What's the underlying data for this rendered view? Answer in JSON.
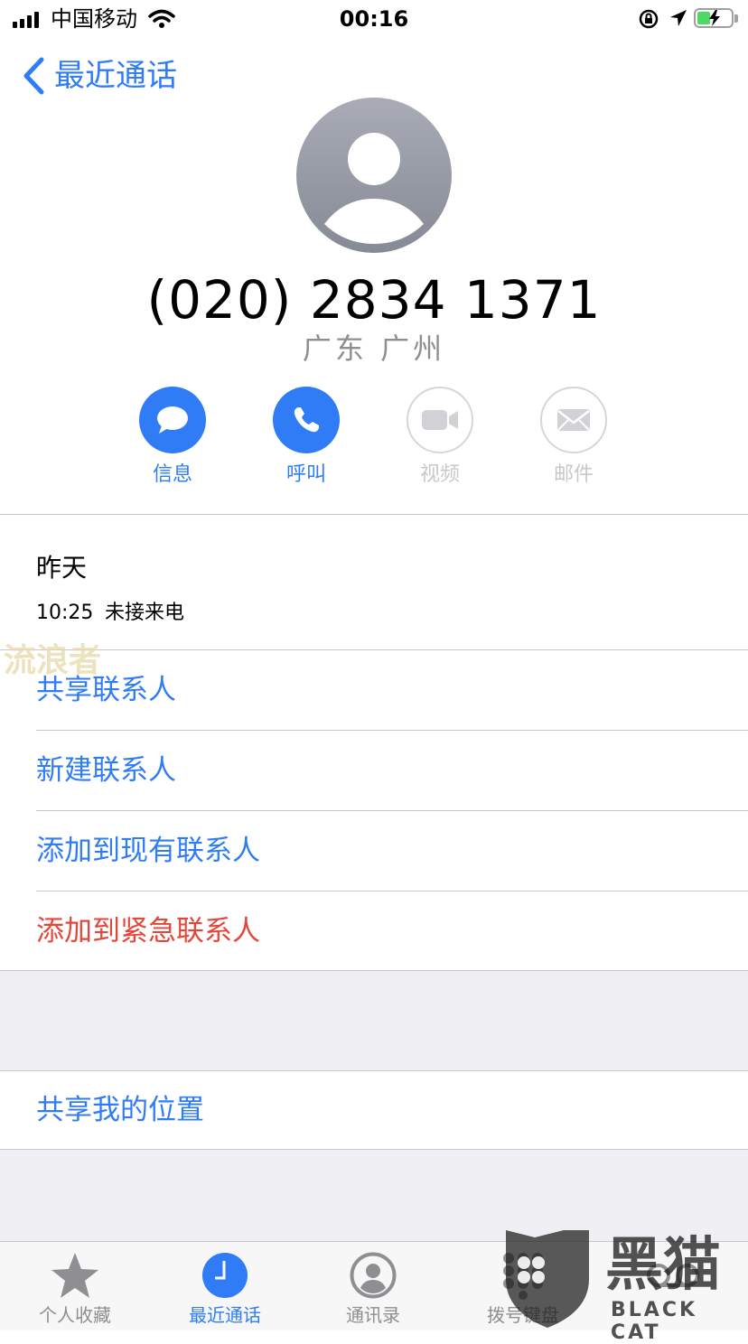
{
  "status_bar": {
    "carrier": "中国移动",
    "time": "00:16"
  },
  "nav": {
    "back_label": "最近通话"
  },
  "contact": {
    "phone_number": "(020) 2834 1371",
    "location": "广东 广州"
  },
  "actions": [
    {
      "label": "信息",
      "icon": "message-icon",
      "enabled": true
    },
    {
      "label": "呼叫",
      "icon": "phone-icon",
      "enabled": true
    },
    {
      "label": "视频",
      "icon": "video-icon",
      "enabled": false
    },
    {
      "label": "邮件",
      "icon": "mail-icon",
      "enabled": false
    }
  ],
  "history": {
    "day": "昨天",
    "entries": [
      {
        "time": "10:25",
        "type": "未接来电"
      }
    ]
  },
  "options": {
    "share_contact": "共享联系人",
    "new_contact": "新建联系人",
    "add_existing": "添加到现有联系人",
    "add_emergency": "添加到紧急联系人",
    "share_location": "共享我的位置"
  },
  "tabbar": [
    {
      "label": "个人收藏",
      "icon": "star-icon",
      "active": false
    },
    {
      "label": "最近通话",
      "icon": "clock-icon",
      "active": true
    },
    {
      "label": "通讯录",
      "icon": "contacts-icon",
      "active": false
    },
    {
      "label": "拨号键盘",
      "icon": "keypad-icon",
      "active": false
    }
  ],
  "watermarks": {
    "overlay_text": "流浪者",
    "brand_text": "BLACK CAT",
    "brand_glyphs": "黑猫"
  },
  "colors": {
    "accent": "#2f7cf6",
    "destructive": "#e5463a",
    "disabled": "#c7c7cc",
    "grouped_background": "#efeff4"
  }
}
